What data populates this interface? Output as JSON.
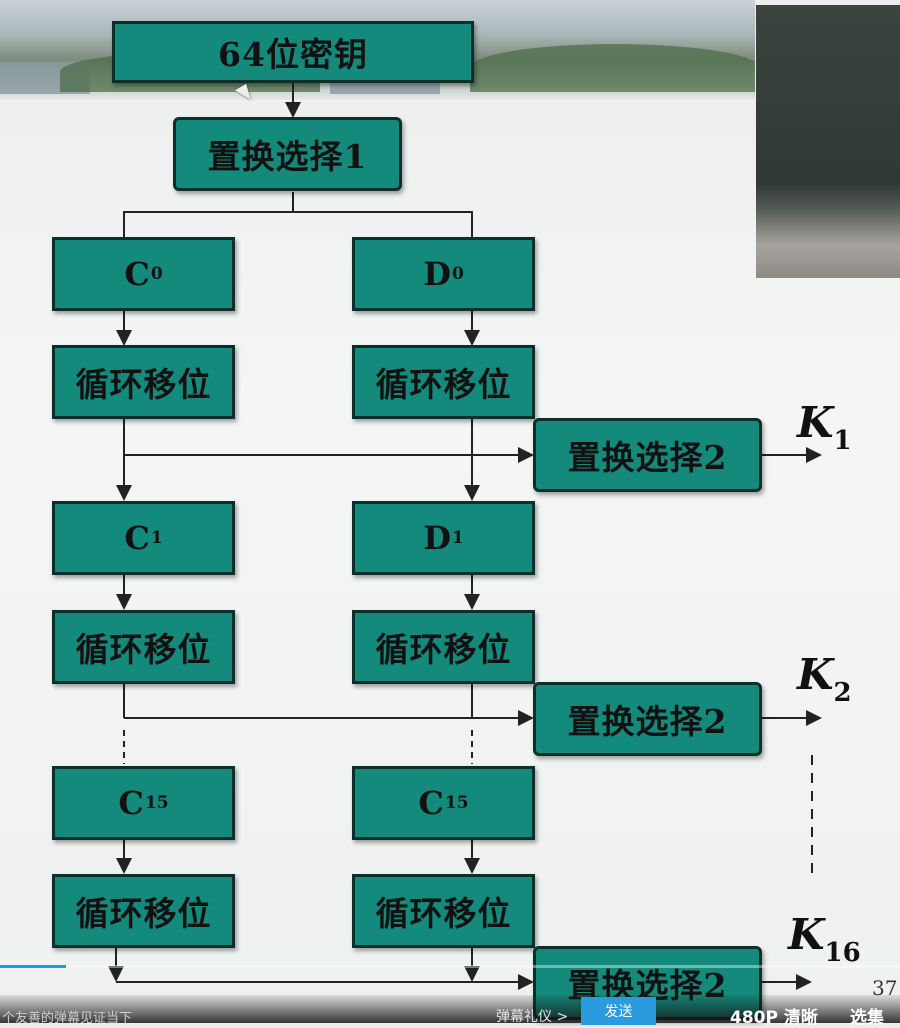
{
  "diagram": {
    "key_box": "64位密钥",
    "pc1": "置换选择1",
    "pc2": "置换选择2",
    "rotate": "循环移位",
    "c_letter": "C",
    "d_letter": "D",
    "c0_sub": "0",
    "d0_sub": "0",
    "c1_sub": "1",
    "d1_sub": "1",
    "c15_sub": "15",
    "d15_letter": "C",
    "d15_sub": "15",
    "k_letter": "K",
    "k1_sub": "1",
    "k2_sub": "2",
    "k16_sub": "16",
    "page_number": "37"
  },
  "player": {
    "danmu_hint": "个友善的弹幕见证当下",
    "etiquette": "弹幕礼仪 >",
    "send": "发送",
    "quality": "480P 清晰",
    "episodes": "选集"
  },
  "colors": {
    "box_fill": "#138a7c",
    "box_border": "#0d2f2b",
    "line": "#222222",
    "accent": "#2b9be0"
  }
}
